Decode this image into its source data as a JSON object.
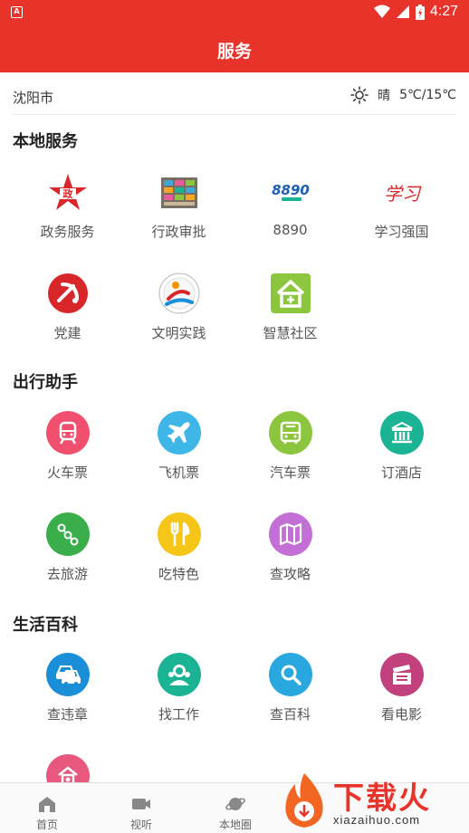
{
  "status_bar": {
    "time": "4:27",
    "app_icon_letter": "A"
  },
  "header": {
    "title": "服务"
  },
  "location": {
    "city": "沈阳市",
    "weather_condition": "晴",
    "temperature": "5℃/15℃"
  },
  "sections": {
    "local": {
      "title": "本地服务",
      "items": [
        {
          "label": "政务服务",
          "icon": "government-star-icon"
        },
        {
          "label": "行政审批",
          "icon": "approval-hall-icon"
        },
        {
          "label": "8890",
          "icon": "hotline-8890-icon"
        },
        {
          "label": "学习强国",
          "icon": "xuexi-qiangguo-icon"
        },
        {
          "label": "党建",
          "icon": "party-emblem-icon"
        },
        {
          "label": "文明实践",
          "icon": "civilization-practice-icon"
        },
        {
          "label": "智慧社区",
          "icon": "smart-community-icon"
        }
      ]
    },
    "travel": {
      "title": "出行助手",
      "items": [
        {
          "label": "火车票",
          "icon": "train-icon",
          "color": "#f0506e"
        },
        {
          "label": "飞机票",
          "icon": "airplane-icon",
          "color": "#3fb6e8"
        },
        {
          "label": "汽车票",
          "icon": "bus-icon",
          "color": "#8cc63f"
        },
        {
          "label": "订酒店",
          "icon": "hotel-icon",
          "color": "#1ab394"
        },
        {
          "label": "去旅游",
          "icon": "route-icon",
          "color": "#3aae4a"
        },
        {
          "label": "吃特色",
          "icon": "fork-knife-icon",
          "color": "#f5c518"
        },
        {
          "label": "查攻略",
          "icon": "map-icon",
          "color": "#c46fd6"
        }
      ]
    },
    "life": {
      "title": "生活百科",
      "items": [
        {
          "label": "查违章",
          "icon": "car-violation-icon",
          "color": "#1a8fd8"
        },
        {
          "label": "找工作",
          "icon": "job-search-icon",
          "color": "#1ab394"
        },
        {
          "label": "查百科",
          "icon": "magnifier-icon",
          "color": "#29a8e0"
        },
        {
          "label": "看电影",
          "icon": "clapperboard-icon",
          "color": "#c2407e"
        }
      ]
    }
  },
  "tabs": [
    {
      "label": "首页",
      "icon": "home-icon"
    },
    {
      "label": "视听",
      "icon": "video-icon"
    },
    {
      "label": "本地圈",
      "icon": "planet-icon"
    }
  ],
  "watermark": {
    "text": "下载火",
    "url": "xiazaihuo.com"
  },
  "colors": {
    "brand_red": "#e8332a"
  }
}
